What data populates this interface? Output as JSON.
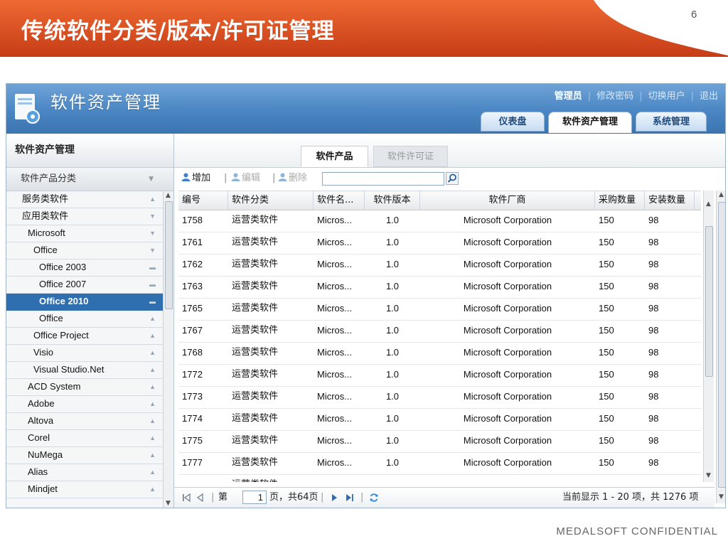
{
  "slide": {
    "title": "传统软件分类/版本/许可证管理",
    "page_number": "6",
    "footer": "MEDALSOFT CONFIDENTIAL",
    "banner_color": "#d9481f"
  },
  "app": {
    "title": "软件资产管理",
    "user_links": {
      "user": "管理员",
      "change_password": "修改密码",
      "switch_user": "切换用户",
      "logout": "退出"
    },
    "top_tabs": [
      "仪表盘",
      "软件资产管理",
      "系统管理"
    ],
    "active_top_tab": "软件资产管理"
  },
  "sidebar": {
    "title": "软件资产管理",
    "section": "软件产品分类",
    "tree": [
      {
        "label": "服务类软件",
        "indent": 0
      },
      {
        "label": "应用类软件",
        "indent": 0
      },
      {
        "label": "Microsoft",
        "indent": 1
      },
      {
        "label": "Office",
        "indent": 2
      },
      {
        "label": "Office 2003",
        "indent": 3
      },
      {
        "label": "Office 2007",
        "indent": 3
      },
      {
        "label": "Office 2010",
        "indent": 3,
        "selected": true
      },
      {
        "label": "Office",
        "indent": 3
      },
      {
        "label": "Office Project",
        "indent": 2
      },
      {
        "label": "Visio",
        "indent": 2
      },
      {
        "label": "Visual Studio.Net",
        "indent": 2
      },
      {
        "label": "ACD System",
        "indent": 1
      },
      {
        "label": "Adobe",
        "indent": 1
      },
      {
        "label": "Altova",
        "indent": 1
      },
      {
        "label": "Corel",
        "indent": 1
      },
      {
        "label": "NuMega",
        "indent": 1
      },
      {
        "label": "Alias",
        "indent": 1
      },
      {
        "label": "Mindjet",
        "indent": 1
      }
    ]
  },
  "content": {
    "tabs": [
      "软件产品",
      "软件许可证"
    ],
    "active_tab": "软件产品",
    "toolbar": {
      "add": "增加",
      "edit": "编辑",
      "delete": "删除",
      "search_value": ""
    },
    "columns": [
      "编号",
      "软件分类",
      "软件名...",
      "软件版本",
      "软件厂商",
      "采购数量",
      "安装数量"
    ],
    "rows": [
      [
        "1758",
        "运营类软件",
        "Micros...",
        "1.0",
        "Microsoft Corporation",
        "150",
        "98"
      ],
      [
        "1761",
        "运营类软件",
        "Micros...",
        "1.0",
        "Microsoft Corporation",
        "150",
        "98"
      ],
      [
        "1762",
        "运营类软件",
        "Micros...",
        "1.0",
        "Microsoft Corporation",
        "150",
        "98"
      ],
      [
        "1763",
        "运营类软件",
        "Micros...",
        "1.0",
        "Microsoft Corporation",
        "150",
        "98"
      ],
      [
        "1765",
        "运营类软件",
        "Micros...",
        "1.0",
        "Microsoft Corporation",
        "150",
        "98"
      ],
      [
        "1767",
        "运营类软件",
        "Micros...",
        "1.0",
        "Microsoft Corporation",
        "150",
        "98"
      ],
      [
        "1768",
        "运营类软件",
        "Micros...",
        "1.0",
        "Microsoft Corporation",
        "150",
        "98"
      ],
      [
        "1772",
        "运营类软件",
        "Micros...",
        "1.0",
        "Microsoft Corporation",
        "150",
        "98"
      ],
      [
        "1773",
        "运营类软件",
        "Micros...",
        "1.0",
        "Microsoft Corporation",
        "150",
        "98"
      ],
      [
        "1774",
        "运营类软件",
        "Micros...",
        "1.0",
        "Microsoft Corporation",
        "150",
        "98"
      ],
      [
        "1775",
        "运营类软件",
        "Micros...",
        "1.0",
        "Microsoft Corporation",
        "150",
        "98"
      ],
      [
        "1777",
        "运营类软件",
        "Micros...",
        "1.0",
        "Microsoft Corporation",
        "150",
        "98"
      ],
      [
        "",
        "运营类软件",
        "",
        "",
        "",
        "",
        ""
      ]
    ],
    "pager": {
      "page_prefix": "第",
      "page_value": "1",
      "page_suffix": "页，共64页",
      "summary": "当前显示 1 - 20 项，共 1276 项"
    }
  }
}
